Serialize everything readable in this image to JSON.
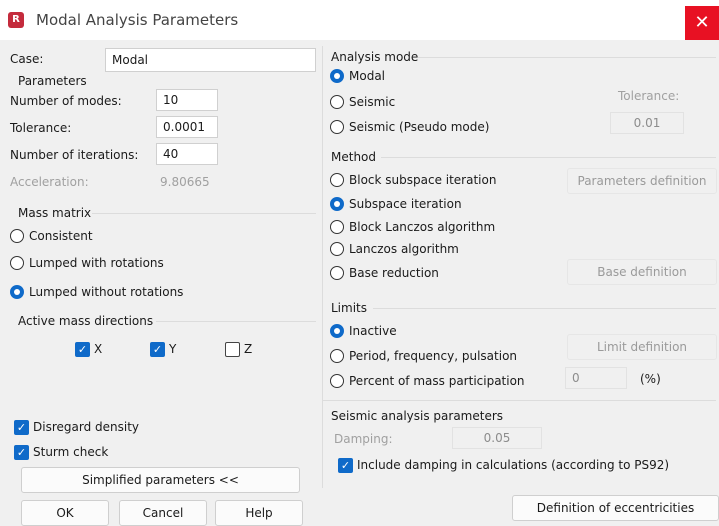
{
  "window": {
    "title": "Modal Analysis Parameters",
    "app_icon_letter": "R",
    "close_glyph": "✕"
  },
  "case": {
    "label": "Case:",
    "value": "Modal"
  },
  "parameters": {
    "title": "Parameters",
    "modes_label": "Number of modes:",
    "modes_value": "10",
    "tolerance_label": "Tolerance:",
    "tolerance_value": "0.0001",
    "iterations_label": "Number of iterations:",
    "iterations_value": "40",
    "acceleration_label": "Acceleration:",
    "acceleration_value": "9.80665"
  },
  "mass_matrix": {
    "title": "Mass matrix",
    "options": [
      "Consistent",
      "Lumped with rotations",
      "Lumped without rotations"
    ],
    "selected": "Lumped without rotations"
  },
  "active_mass": {
    "title": "Active mass directions",
    "x_label": "X",
    "y_label": "Y",
    "z_label": "Z",
    "x_checked": true,
    "y_checked": true,
    "z_checked": false
  },
  "options": {
    "disregard_density_label": "Disregard density",
    "disregard_density_checked": true,
    "sturm_check_label": "Sturm check",
    "sturm_check_checked": true,
    "simplified_button": "Simplified parameters <<"
  },
  "footer": {
    "ok": "OK",
    "cancel": "Cancel",
    "help": "Help"
  },
  "analysis_mode": {
    "title": "Analysis mode",
    "options": [
      "Modal",
      "Seismic",
      "Seismic (Pseudo mode)"
    ],
    "selected": "Modal",
    "tolerance_label": "Tolerance:",
    "tolerance_value": "0.01"
  },
  "method": {
    "title": "Method",
    "options": [
      "Block subspace iteration",
      "Subspace iteration",
      "Block Lanczos algorithm",
      "Lanczos algorithm",
      "Base reduction"
    ],
    "selected": "Subspace iteration",
    "parameters_definition_button": "Parameters definition",
    "base_definition_button": "Base definition"
  },
  "limits": {
    "title": "Limits",
    "options": [
      "Inactive",
      "Period, frequency, pulsation",
      "Percent of mass participation"
    ],
    "selected": "Inactive",
    "limit_definition_button": "Limit definition",
    "percent_value": "0",
    "percent_unit": "(%)"
  },
  "seismic_params": {
    "title": "Seismic analysis parameters",
    "damping_label": "Damping:",
    "damping_value": "0.05",
    "include_damping_label": "Include damping in calculations (according to PS92)",
    "include_damping_checked": true
  },
  "eccentricities_button": "Definition of eccentricities",
  "colors": {
    "accent": "#0f6ac9",
    "close": "#e81123",
    "app_icon": "#c42b3c"
  }
}
